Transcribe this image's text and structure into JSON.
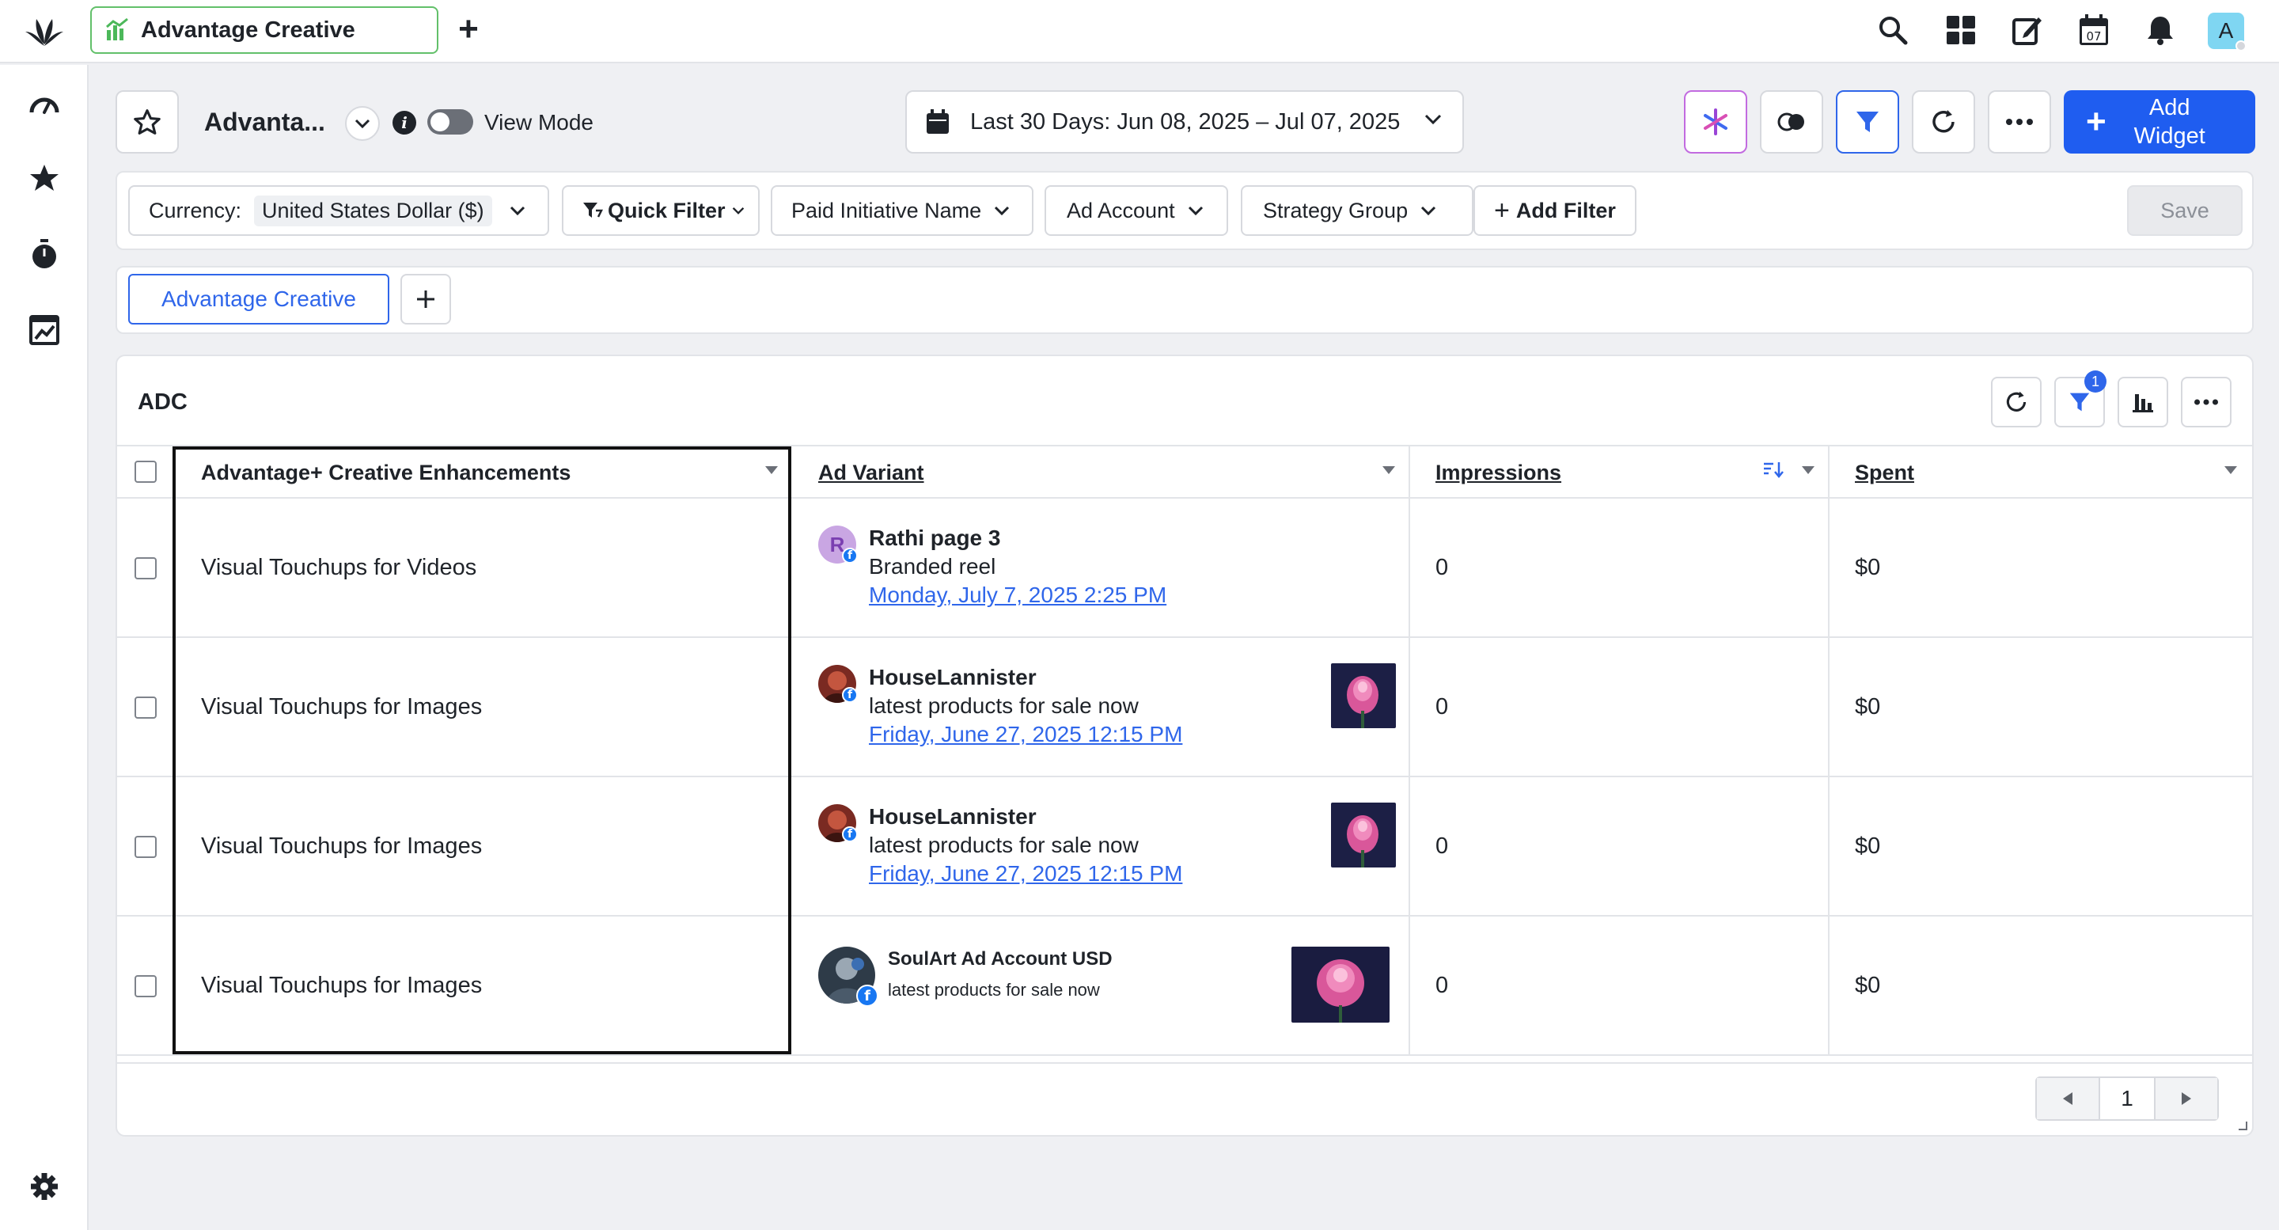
{
  "app": {
    "tab_title": "Advantage Creative",
    "avatar_initial": "A",
    "calendar_day": "07"
  },
  "header": {
    "dashboard_title": "Advanta...",
    "view_mode_label": "View Mode",
    "date_range": "Last 30 Days: Jun 08, 2025 – Jul 07, 2025",
    "add_widget_label": "Add Widget"
  },
  "filters": {
    "currency_label": "Currency:",
    "currency_value": "United States Dollar ($)",
    "quick_filter": "Quick Filter",
    "items": [
      "Paid Initiative Name",
      "Ad Account",
      "Strategy Group"
    ],
    "add_filter": "Add Filter",
    "save": "Save"
  },
  "page_tabs": {
    "active": "Advantage Creative"
  },
  "widget": {
    "title": "ADC",
    "filter_badge": "1",
    "columns": [
      "Advantage+ Creative Enhancements",
      "Ad Variant",
      "Impressions",
      "Spent"
    ],
    "rows": [
      {
        "enhancement": "Visual Touchups for Videos",
        "account": "Rathi page 3",
        "avatar": "R",
        "caption": "Branded reel",
        "date": "Monday, July 7, 2025 2:25 PM",
        "impressions": "0",
        "spent": "$0"
      },
      {
        "enhancement": "Visual Touchups for Images",
        "account": "HouseLannister",
        "caption": "latest products for sale now",
        "date": "Friday, June 27, 2025 12:15 PM",
        "impressions": "0",
        "spent": "$0"
      },
      {
        "enhancement": "Visual Touchups for Images",
        "account": "HouseLannister",
        "caption": "latest products for sale now",
        "date": "Friday, June 27, 2025 12:15 PM",
        "impressions": "0",
        "spent": "$0"
      },
      {
        "enhancement": "Visual Touchups for Images",
        "account": "SoulArt Ad Account USD",
        "caption": "latest products for sale now",
        "impressions": "0",
        "spent": "$0"
      }
    ],
    "page_number": "1"
  }
}
